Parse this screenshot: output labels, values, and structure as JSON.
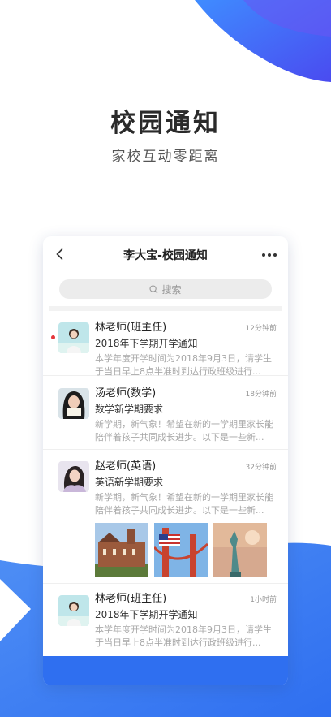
{
  "hero": {
    "title": "校园通知",
    "subtitle": "家校互动零距离"
  },
  "nav": {
    "title": "李大宝-校园通知",
    "back_icon": "chevron-left-icon",
    "more_icon": "more-dots-icon"
  },
  "search": {
    "placeholder": "搜索",
    "icon": "search-icon"
  },
  "messages": [
    {
      "sender": "林老师(班主任)",
      "time": "12分钟前",
      "subject": "2018年下学期开学通知",
      "preview_line1": "本学年度开学时间为2018年9月3日，请学生",
      "preview_line2": "于当日早上8点半准时到达行政班级进行...",
      "unread": true
    },
    {
      "sender": "汤老师(数学)",
      "time": "18分钟前",
      "subject": "数学新学期要求",
      "preview_line1": "新学期，新气象！希望在新的一学期里家长能",
      "preview_line2": "陪伴着孩子共同成长进步。以下是一些新...",
      "unread": false
    },
    {
      "sender": "赵老师(英语)",
      "time": "32分钟前",
      "subject": "英语新学期要求",
      "preview_line1": "新学期，新气象！希望在新的一学期里家长能",
      "preview_line2": "陪伴着孩子共同成长进步。以下是一些新...",
      "unread": false
    },
    {
      "sender": "林老师(班主任)",
      "time": "1小时前",
      "subject": "2018年下学期开学通知",
      "preview_line1": "本学年度开学时间为2018年9月3日，请学生",
      "preview_line2": "于当日早上8点半准时到达行政班级进行...",
      "unread": false
    }
  ],
  "colors": {
    "brand_blue": "#2f6ff0",
    "unread_dot": "#e4363b"
  }
}
